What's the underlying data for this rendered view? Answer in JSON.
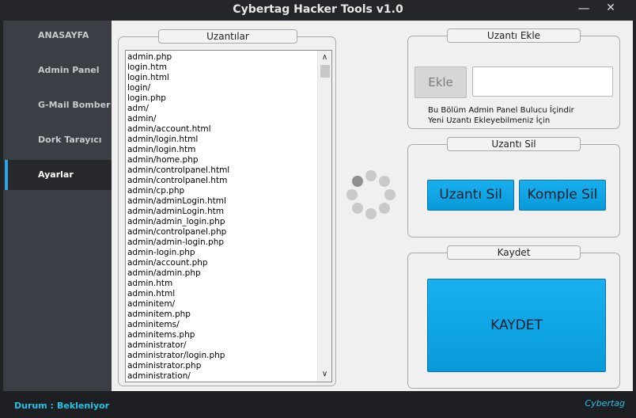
{
  "window": {
    "title": "Cybertag Hacker Tools v1.0",
    "minimize": "—",
    "close": "✕"
  },
  "sidebar": {
    "items": [
      {
        "label": "ANASAYFA"
      },
      {
        "label": "Admin Panel"
      },
      {
        "label": "G-Mail Bomber"
      },
      {
        "label": "Dork Tarayıcı"
      },
      {
        "label": "Ayarlar",
        "active": true
      }
    ]
  },
  "extensions": {
    "title": "Uzantılar",
    "items": [
      "admin.php",
      "login.htm",
      "login.html",
      "login/",
      "login.php",
      "adm/",
      "admin/",
      "admin/account.html",
      "admin/login.html",
      "admin/login.htm",
      "admin/home.php",
      "admin/controlpanel.html",
      "admin/controlpanel.htm",
      "admin/cp.php",
      "admin/adminLogin.html",
      "admin/adminLogin.htm",
      "admin/admin_login.php",
      "admin/controlpanel.php",
      "admin/admin-login.php",
      "admin-login.php",
      "admin/account.php",
      "admin/admin.php",
      "admin.htm",
      "admin.html",
      "adminitem/",
      "adminitem.php",
      "adminitems/",
      "adminitems.php",
      "administrator/",
      "administrator/login.php",
      "administrator.php",
      "administration/"
    ],
    "scroll_up": "∧",
    "scroll_down": "∨"
  },
  "add_panel": {
    "title": "Uzantı Ekle",
    "button_label": "Ekle",
    "input_value": "",
    "info_line1": "Bu Bölüm Admin Panel Bulucu İçindir",
    "info_line2": "Yeni Uzantı Ekleyebilmeniz İçin"
  },
  "delete_panel": {
    "title": "Uzantı Sil",
    "delete_button": "Uzantı Sil",
    "delete_all_button": "Komple Sil"
  },
  "save_panel": {
    "title": "Kaydet",
    "save_button": "KAYDET"
  },
  "status": {
    "label": "Durum :",
    "value": "Bekleniyor",
    "brand": "Cybertag"
  },
  "colors": {
    "accent": "#2fa3e6",
    "button_blue": "#0aa4e8",
    "status_text": "#21c3e6",
    "sidebar_bg": "#3b3e44"
  }
}
